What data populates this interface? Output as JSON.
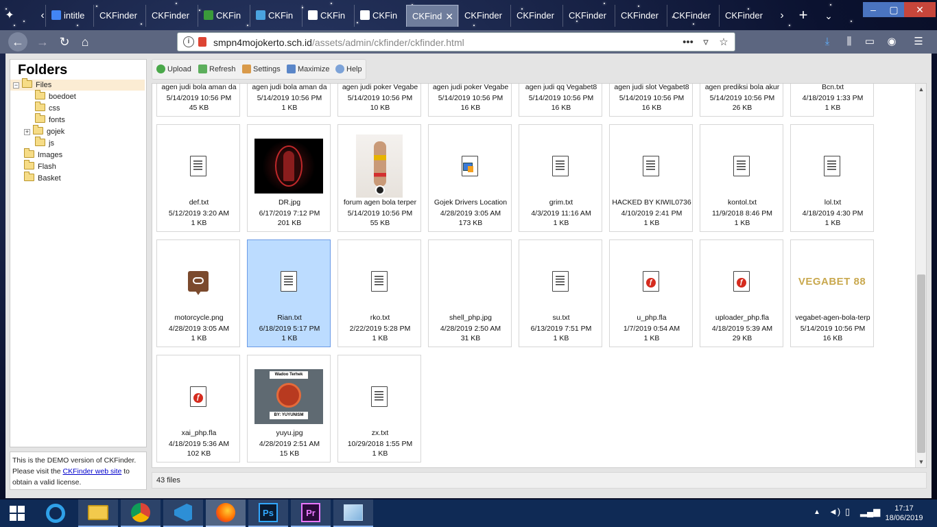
{
  "browser": {
    "tabs": [
      {
        "label": "intitle",
        "icon": "google-icon",
        "color": "#4285f4"
      },
      {
        "label": "CKFinder",
        "icon": "",
        "color": ""
      },
      {
        "label": "CKFinder",
        "icon": "",
        "color": ""
      },
      {
        "label": "CKFin",
        "icon": "leaf-icon",
        "color": "#3a9a3a"
      },
      {
        "label": "CKFin",
        "icon": "snowflake-icon",
        "color": "#4aa3df"
      },
      {
        "label": "CKFin",
        "icon": "in-logo-icon",
        "color": "#ffffff"
      },
      {
        "label": "CKFin",
        "icon": "in-logo-icon",
        "color": "#ffffff"
      },
      {
        "label": "CKFind",
        "icon": "",
        "color": ""
      },
      {
        "label": "CKFinder",
        "icon": "",
        "color": ""
      },
      {
        "label": "CKFinder",
        "icon": "",
        "color": ""
      },
      {
        "label": "CKFinder",
        "icon": "",
        "color": ""
      },
      {
        "label": "CKFinder",
        "icon": "",
        "color": ""
      },
      {
        "label": "CKFinder",
        "icon": "",
        "color": ""
      },
      {
        "label": "CKFinder",
        "icon": "",
        "color": ""
      }
    ],
    "url_domain": "smpn4mojokerto.sch.id",
    "url_path": "/assets/admin/ckfinder/ckfinder.html"
  },
  "ckfinder": {
    "folders_title": "Folders",
    "tree": [
      {
        "label": "Files",
        "toggle": "−",
        "selected": true
      },
      {
        "label": "boedoet",
        "toggle": "",
        "selected": false
      },
      {
        "label": "css",
        "toggle": "",
        "selected": false
      },
      {
        "label": "fonts",
        "toggle": "",
        "selected": false
      },
      {
        "label": "gojek",
        "toggle": "+",
        "selected": false
      },
      {
        "label": "js",
        "toggle": "",
        "selected": false
      },
      {
        "label": "Images",
        "toggle": "",
        "selected": false
      },
      {
        "label": "Flash",
        "toggle": "",
        "selected": false
      },
      {
        "label": "Basket",
        "toggle": "",
        "selected": false
      }
    ],
    "demo_note": {
      "line1": "This is the DEMO version of CKFinder.",
      "line2_pre": "Please visit the",
      "link": "CKFinder web site",
      "line2_post": "to",
      "line3": "obtain a valid license."
    },
    "toolbar": {
      "upload": "Upload",
      "refresh": "Refresh",
      "settings": "Settings",
      "maximize": "Maximize",
      "help": "Help"
    },
    "files": [
      {
        "name": "agen judi bola aman da",
        "date": "5/14/2019 10:56 PM",
        "size": "45 KB",
        "kind": "partial"
      },
      {
        "name": "agen judi bola aman da",
        "date": "5/14/2019 10:56 PM",
        "size": "1 KB",
        "kind": "partial"
      },
      {
        "name": "agen judi poker Vegabe",
        "date": "5/14/2019 10:56 PM",
        "size": "10 KB",
        "kind": "partial"
      },
      {
        "name": "agen judi poker Vegabe",
        "date": "5/14/2019 10:56 PM",
        "size": "16 KB",
        "kind": "partial"
      },
      {
        "name": "agen judi qq Vegabet8",
        "date": "5/14/2019 10:56 PM",
        "size": "16 KB",
        "kind": "partial"
      },
      {
        "name": "agen judi slot Vegabet8",
        "date": "5/14/2019 10:56 PM",
        "size": "16 KB",
        "kind": "partial"
      },
      {
        "name": "agen prediksi bola akur",
        "date": "5/14/2019 10:56 PM",
        "size": "26 KB",
        "kind": "partial"
      },
      {
        "name": "Bcn.txt",
        "date": "4/18/2019 1:33 PM",
        "size": "1 KB",
        "kind": "partial"
      },
      {
        "name": "def.txt",
        "date": "5/12/2019 3:20 AM",
        "size": "1 KB",
        "kind": "txt"
      },
      {
        "name": "DR.jpg",
        "date": "6/17/2019 7:12 PM",
        "size": "201 KB",
        "kind": "img-dr"
      },
      {
        "name": "forum agen bola terper",
        "date": "5/14/2019 10:56 PM",
        "size": "55 KB",
        "kind": "img-model"
      },
      {
        "name": "Gojek Drivers Location",
        "date": "4/28/2019 3:05 AM",
        "size": "173 KB",
        "kind": "web"
      },
      {
        "name": "grim.txt",
        "date": "4/3/2019 11:16 AM",
        "size": "1 KB",
        "kind": "txt"
      },
      {
        "name": "HACKED BY KIWIL0736",
        "date": "4/10/2019 2:41 PM",
        "size": "1 KB",
        "kind": "txt"
      },
      {
        "name": "kontol.txt",
        "date": "11/9/2018 8:46 PM",
        "size": "1 KB",
        "kind": "txt"
      },
      {
        "name": "lol.txt",
        "date": "4/18/2019 4:30 PM",
        "size": "1 KB",
        "kind": "txt"
      },
      {
        "name": "motorcycle.png",
        "date": "4/28/2019 3:05 AM",
        "size": "1 KB",
        "kind": "pin"
      },
      {
        "name": "Rian.txt",
        "date": "6/18/2019 5:17 PM",
        "size": "1 KB",
        "kind": "txt",
        "selected": true
      },
      {
        "name": "rko.txt",
        "date": "2/22/2019 5:28 PM",
        "size": "1 KB",
        "kind": "txt"
      },
      {
        "name": "shell_php.jpg",
        "date": "4/28/2019 2:50 AM",
        "size": "31 KB",
        "kind": "blank"
      },
      {
        "name": "su.txt",
        "date": "6/13/2019 7:51 PM",
        "size": "1 KB",
        "kind": "txt"
      },
      {
        "name": "u_php.fla",
        "date": "1/7/2019 0:54 AM",
        "size": "1 KB",
        "kind": "fla"
      },
      {
        "name": "uploader_php.fla",
        "date": "4/18/2019 5:39 AM",
        "size": "29 KB",
        "kind": "fla"
      },
      {
        "name": "vegabet-agen-bola-terp",
        "date": "5/14/2019 10:56 PM",
        "size": "16 KB",
        "kind": "img-vegabet"
      },
      {
        "name": "xai_php.fla",
        "date": "4/18/2019 5:36 AM",
        "size": "102 KB",
        "kind": "fla"
      },
      {
        "name": "yuyu.jpg",
        "date": "4/28/2019 2:51 AM",
        "size": "15 KB",
        "kind": "img-yuyu"
      },
      {
        "name": "zx.txt",
        "date": "10/29/2018 1:55 PM",
        "size": "1 KB",
        "kind": "txt"
      }
    ],
    "thumb_texts": {
      "vegabet_logo": "VEGABET 88",
      "yuyu_top": "Wadoo Terhek",
      "yuyu_bottom": "BY: YUYUNISM"
    },
    "status": "43 files"
  },
  "taskbar": {
    "apps": [
      "start-icon",
      "ie-icon",
      "file-explorer-icon",
      "chrome-icon",
      "vscode-icon",
      "firefox-icon",
      "photoshop-icon",
      "premiere-icon",
      "notepad-icon"
    ],
    "ps_label": "Ps",
    "pr_label": "Pr",
    "time": "17:17",
    "date": "18/06/2019"
  }
}
